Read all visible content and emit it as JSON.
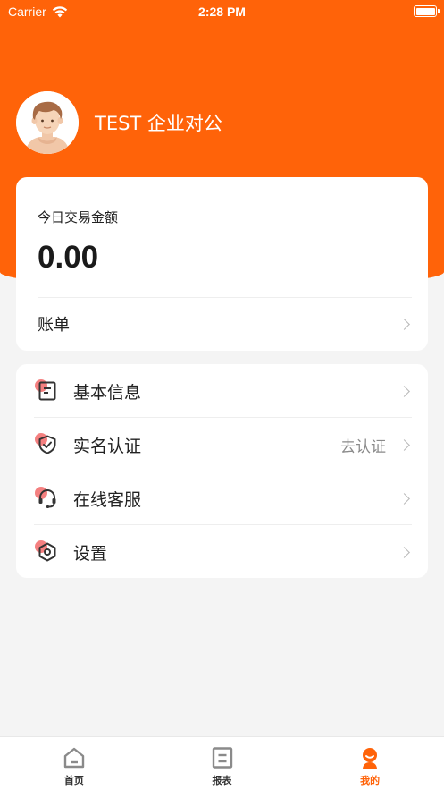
{
  "status_bar": {
    "carrier": "Carrier",
    "time": "2:28 PM"
  },
  "profile": {
    "name": "TEST 企业对公"
  },
  "summary": {
    "today_label": "今日交易金额",
    "today_amount": "0.00",
    "bill_label": "账单"
  },
  "menu": {
    "items": [
      {
        "label": "基本信息",
        "hint": "",
        "icon": "document-icon"
      },
      {
        "label": "实名认证",
        "hint": "去认证",
        "icon": "shield-check-icon"
      },
      {
        "label": "在线客服",
        "hint": "",
        "icon": "headset-icon"
      },
      {
        "label": "设置",
        "hint": "",
        "icon": "settings-hexagon-icon"
      }
    ]
  },
  "tabs": [
    {
      "label": "首页",
      "icon": "home-icon",
      "active": false
    },
    {
      "label": "报表",
      "icon": "report-icon",
      "active": false
    },
    {
      "label": "我的",
      "icon": "profile-icon",
      "active": true
    }
  ],
  "colors": {
    "accent": "#ff6309",
    "background": "#f4f4f4",
    "icon_dot": "#f26a6a"
  }
}
